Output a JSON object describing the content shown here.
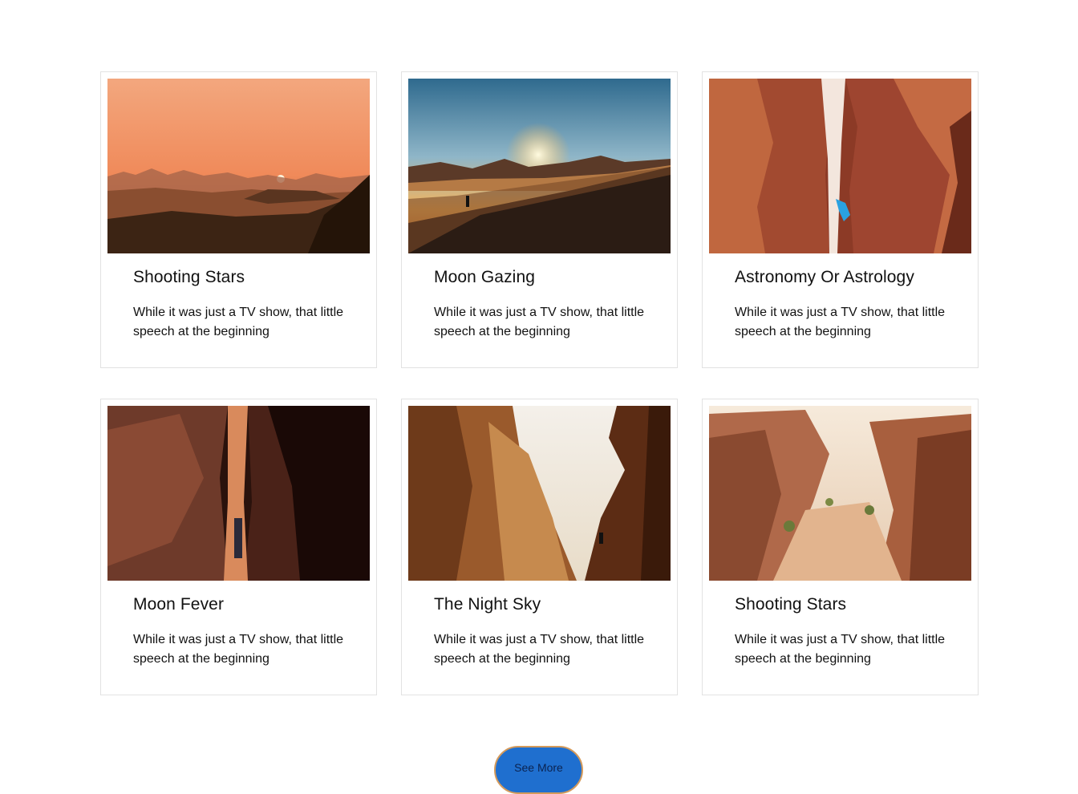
{
  "cards": [
    {
      "title": "Shooting Stars",
      "text": "While it was just a TV show, that little speech at the beginning",
      "image": "desert-sunset-photo"
    },
    {
      "title": "Moon Gazing",
      "text": "While it was just a TV show, that little speech at the beginning",
      "image": "dune-hiker-sunrise-photo"
    },
    {
      "title": "Astronomy Or Astrology",
      "text": "While it was just a TV show, that little speech at the beginning",
      "image": "canyon-climber-photo"
    },
    {
      "title": "Moon Fever",
      "text": "While it was just a TV show, that little speech at the beginning",
      "image": "narrow-slot-canyon-photo"
    },
    {
      "title": "The Night Sky",
      "text": "While it was just a TV show, that little speech at the beginning",
      "image": "cliff-climber-photo"
    },
    {
      "title": "Shooting Stars",
      "text": "While it was just a TV show, that little speech at the beginning",
      "image": "rocky-valley-photo"
    }
  ],
  "see_more_label": "See More",
  "colors": {
    "button": "#1f6fcf",
    "button_border": "#d49a5b",
    "card_border": "#e2e2e2"
  }
}
